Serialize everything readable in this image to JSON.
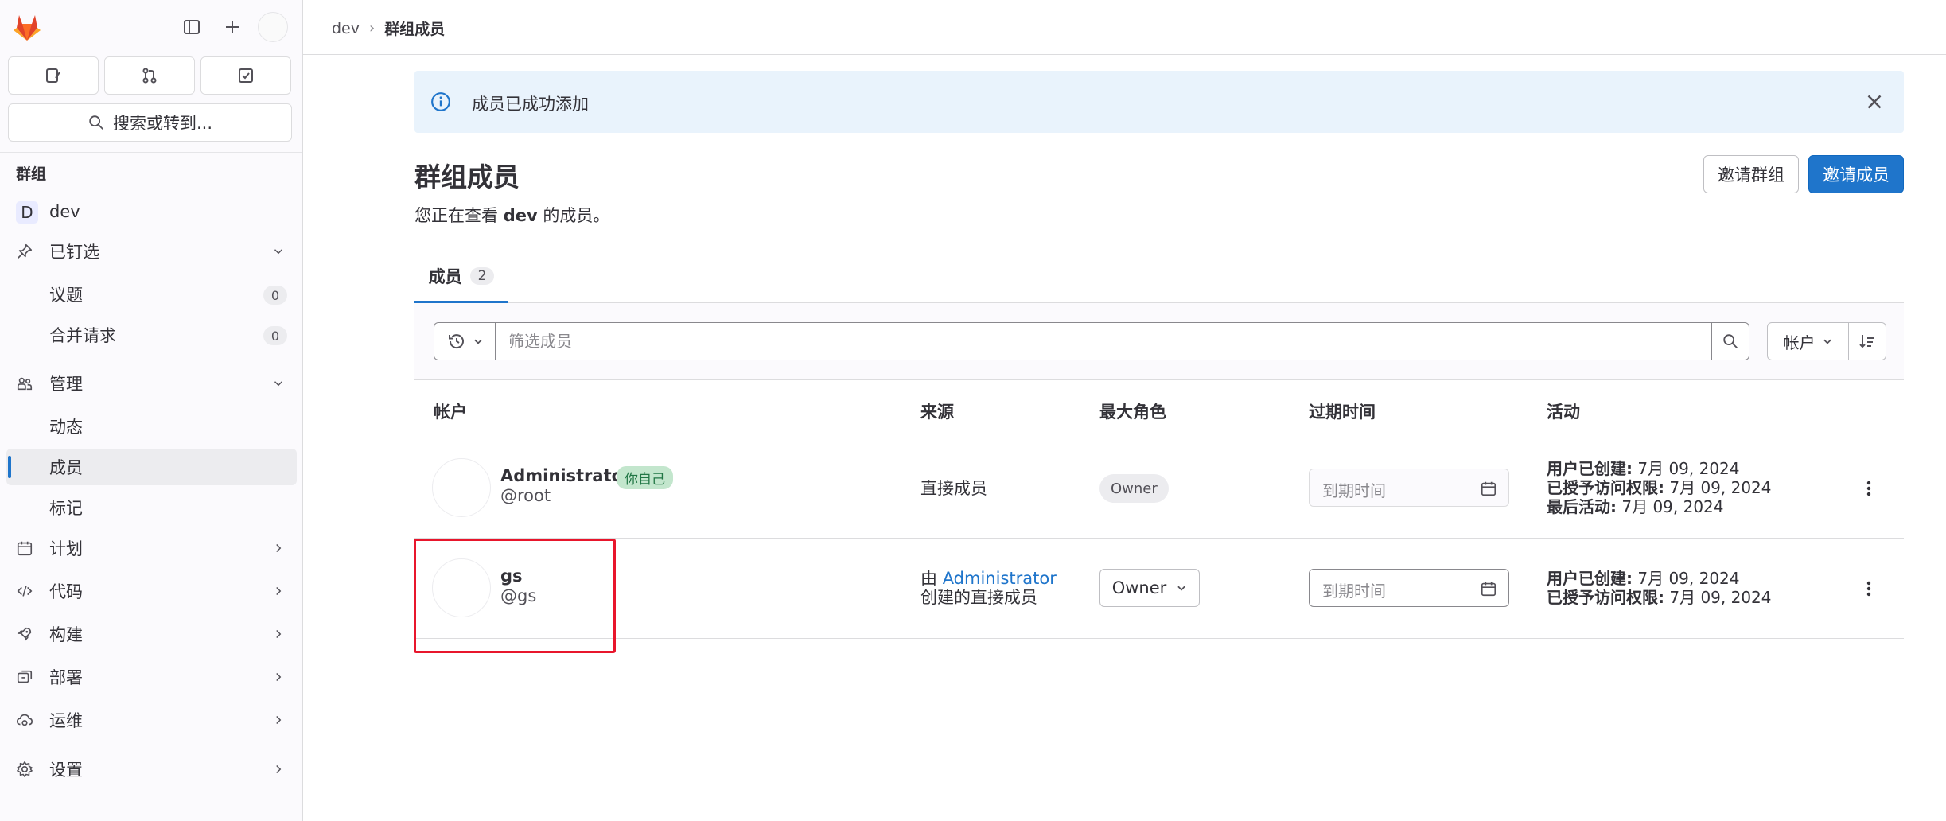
{
  "sidebar": {
    "search_placeholder": "搜索或转到...",
    "section_label": "群组",
    "group": {
      "badge": "D",
      "name": "dev"
    },
    "pinned": {
      "label": "已钉选",
      "items": [
        {
          "label": "议题",
          "count": "0"
        },
        {
          "label": "合并请求",
          "count": "0"
        }
      ]
    },
    "manage": {
      "label": "管理",
      "items": [
        {
          "label": "动态"
        },
        {
          "label": "成员"
        },
        {
          "label": "标记"
        }
      ]
    },
    "nav": [
      {
        "label": "计划"
      },
      {
        "label": "代码"
      },
      {
        "label": "构建"
      },
      {
        "label": "部署"
      },
      {
        "label": "运维"
      },
      {
        "label": "设置"
      }
    ]
  },
  "breadcrumb": {
    "parent": "dev",
    "separator": "›",
    "current": "群组成员"
  },
  "alert": {
    "text": "成员已成功添加"
  },
  "page": {
    "title": "群组成员",
    "desc_prefix": "您正在查看 ",
    "desc_group": "dev",
    "desc_suffix": " 的成员。",
    "invite_group_label": "邀请群组",
    "invite_member_label": "邀请成员"
  },
  "tabs": [
    {
      "label": "成员",
      "count": "2"
    }
  ],
  "filter": {
    "placeholder": "筛选成员",
    "sort_label": "帐户"
  },
  "table": {
    "headers": {
      "account": "帐户",
      "source": "来源",
      "max_role": "最大角色",
      "expiration": "过期时间",
      "activity": "活动"
    },
    "rows": [
      {
        "name": "Administrator",
        "badge": "你自己",
        "username": "@root",
        "source": "直接成员",
        "role": "Owner",
        "expiry_placeholder": "到期时间",
        "activity": [
          {
            "label": "用户已创建:",
            "value": "7月 09, 2024"
          },
          {
            "label": "已授予访问权限:",
            "value": "7月 09, 2024"
          },
          {
            "label": "最后活动:",
            "value": "7月 09, 2024"
          }
        ]
      },
      {
        "name": "gs",
        "username": "@gs",
        "source_prefix": "由 ",
        "source_link": "Administrator",
        "source_suffix": "创建的直接成员",
        "role": "Owner",
        "expiry_placeholder": "到期时间",
        "activity": [
          {
            "label": "用户已创建:",
            "value": "7月 09, 2024"
          },
          {
            "label": "已授予访问权限:",
            "value": "7月 09, 2024"
          }
        ]
      }
    ]
  },
  "colors": {
    "accent": "#1f75cb",
    "highlight": "#e8162c",
    "alert_bg": "#e9f3fc",
    "badge_green": "#c3e6cd"
  }
}
